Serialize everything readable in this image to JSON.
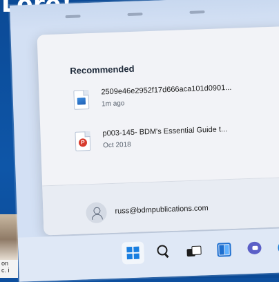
{
  "magazine": {
    "headline_fragment": "Lore!"
  },
  "start_menu": {
    "recommended_title": "Recommended",
    "recommended_items": [
      {
        "name": "2509e46e2952f17d666aca101d0901...",
        "meta": "1m ago",
        "icon": "image-file-icon"
      },
      {
        "name": "p003-145- BDM's Essential Guide t...",
        "meta": "Oct 2018",
        "icon": "pdf-file-icon"
      }
    ],
    "user": {
      "email": "russ@bdmpublications.com",
      "icon": "user-avatar-icon"
    }
  },
  "taskbar": {
    "icons": [
      "windows-start-icon",
      "search-icon",
      "task-view-icon",
      "widgets-icon",
      "teams-chat-icon",
      "edge-browser-icon"
    ]
  },
  "colors": {
    "page_blue": "#0d4f9e",
    "accent": "#1a7fe0"
  }
}
